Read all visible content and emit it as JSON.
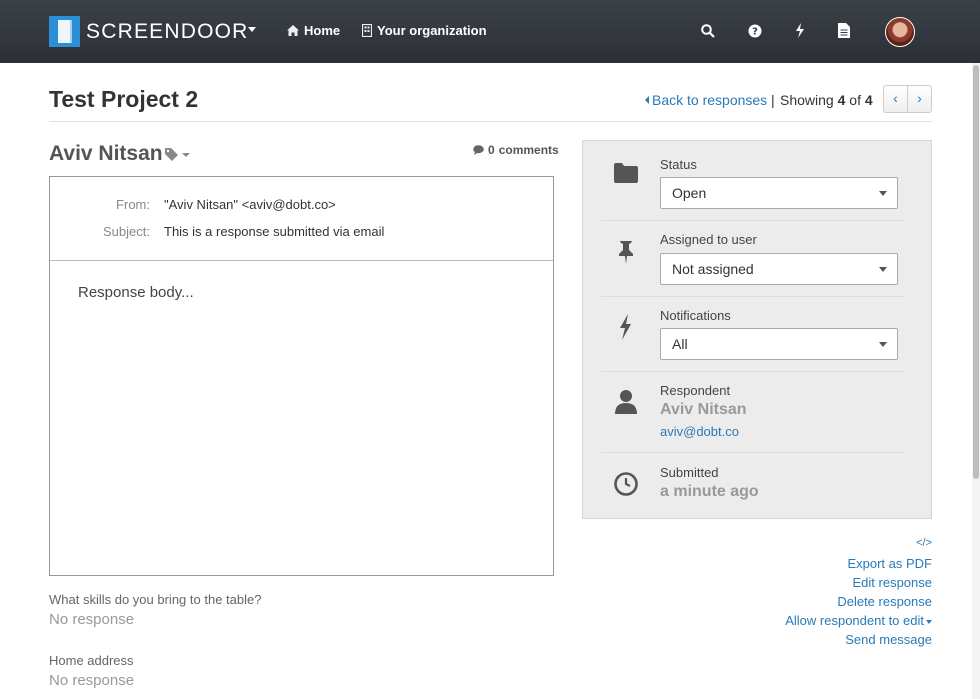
{
  "nav": {
    "brand": "SCREENDOOR",
    "home": "Home",
    "organization": "Your organization"
  },
  "header": {
    "title": "Test Project 2",
    "back": "Back to responses",
    "separator": "|",
    "showing_prefix": "Showing",
    "showing_current": "4",
    "showing_of": "of",
    "showing_total": "4",
    "prev": "‹",
    "next": "›"
  },
  "respondent_heading": {
    "name": "Aviv Nitsan",
    "comments_count": "0",
    "comments_label": "comments"
  },
  "email": {
    "from_label": "From:",
    "from_value": "\"Aviv Nitsan\" <aviv@dobt.co>",
    "subject_label": "Subject:",
    "subject_value": "This is a response submitted via email",
    "body": "Response body..."
  },
  "fields": [
    {
      "label": "What skills do you bring to the table?",
      "value": "No response"
    },
    {
      "label": "Home address",
      "value": "No response"
    }
  ],
  "panel": {
    "status_label": "Status",
    "status_value": "Open",
    "assigned_label": "Assigned to user",
    "assigned_value": "Not assigned",
    "notifications_label": "Notifications",
    "notifications_value": "All",
    "respondent_label": "Respondent",
    "respondent_name": "Aviv Nitsan",
    "respondent_email": "aviv@dobt.co",
    "submitted_label": "Submitted",
    "submitted_value": "a minute ago"
  },
  "actions": {
    "embed": "</>",
    "export_pdf": "Export as PDF",
    "edit": "Edit response",
    "delete": "Delete response",
    "allow_edit": "Allow respondent to edit",
    "send_message": "Send message"
  },
  "colors": {
    "navbar": "#34393f",
    "link": "#2a7ab8",
    "brand_logo": "#2c8fd6",
    "panel_bg": "#ececec"
  }
}
